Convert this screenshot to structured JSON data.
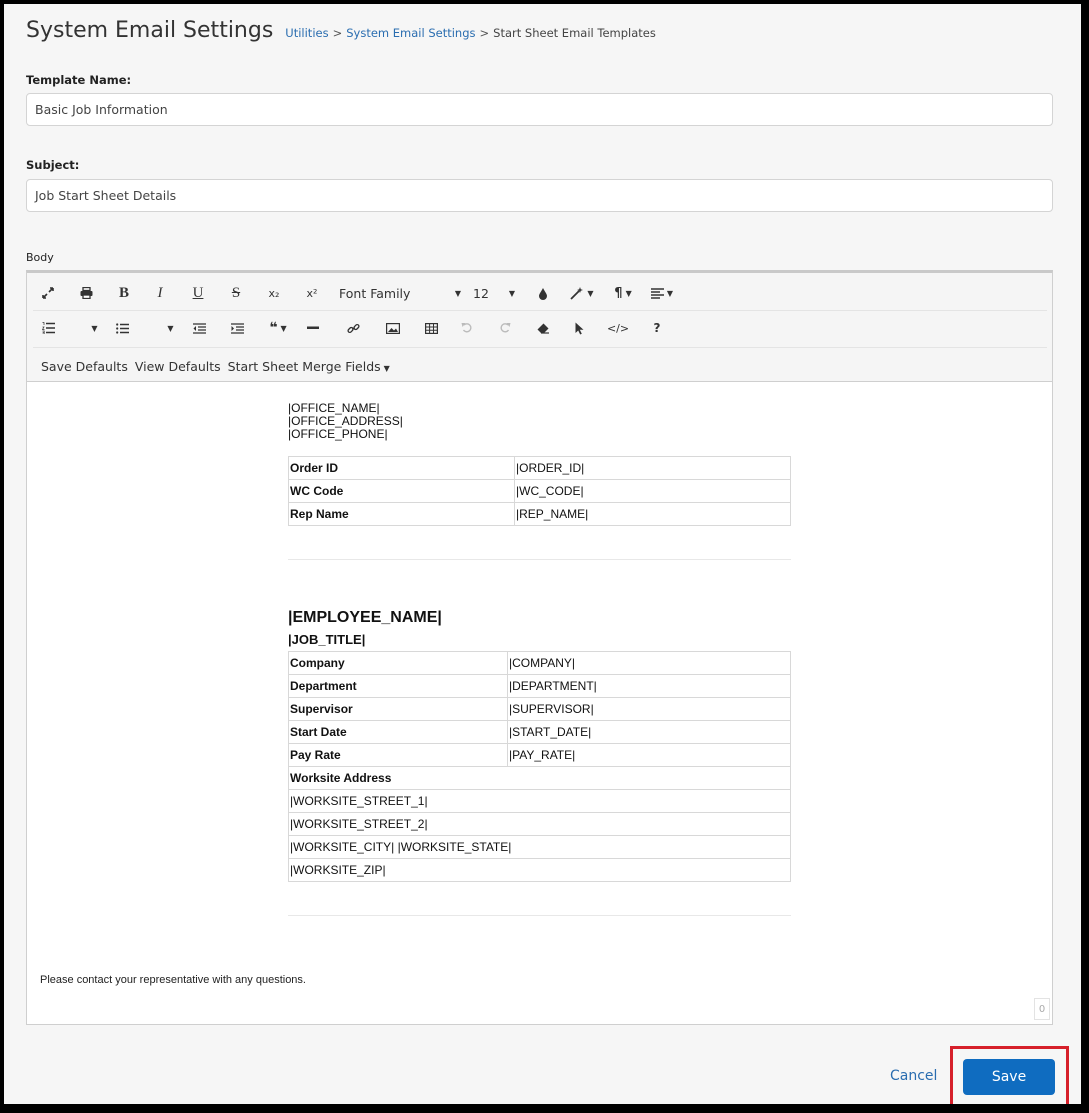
{
  "header": {
    "title": "System Email Settings",
    "breadcrumb": [
      {
        "label": "Utilities"
      },
      {
        "label": "System Email Settings"
      },
      {
        "label": "Start Sheet Email Templates"
      }
    ],
    "separator": ">"
  },
  "form": {
    "template_name_label": "Template Name:",
    "template_name_value": "Basic Job Information",
    "subject_label": "Subject:",
    "subject_value": "Job Start Sheet Details",
    "body_label": "Body"
  },
  "toolbar": {
    "font_family": "Font Family",
    "font_size": "12",
    "bold": "B",
    "italic": "I",
    "underline": "U",
    "strike": "S",
    "subscript": "x₂",
    "superscript": "x²",
    "help": "?",
    "save_defaults": "Save Defaults",
    "view_defaults": "View Defaults",
    "merge_fields": "Start Sheet Merge Fields"
  },
  "body": {
    "office": [
      "|OFFICE_NAME|",
      "|OFFICE_ADDRESS|",
      "|OFFICE_PHONE|"
    ],
    "order_table": [
      {
        "key": "Order ID",
        "value": "|ORDER_ID|"
      },
      {
        "key": "WC Code",
        "value": "|WC_CODE|"
      },
      {
        "key": "Rep Name",
        "value": "|REP_NAME|"
      }
    ],
    "employee_name": "|EMPLOYEE_NAME|",
    "job_title": "|JOB_TITLE|",
    "employee_table": [
      {
        "key": "Company",
        "value": "|COMPANY|"
      },
      {
        "key": "Department",
        "value": "|DEPARTMENT|"
      },
      {
        "key": "Supervisor",
        "value": "|SUPERVISOR|"
      },
      {
        "key": "Start Date",
        "value": "|START_DATE|"
      },
      {
        "key": "Pay Rate",
        "value": "|PAY_RATE|"
      }
    ],
    "worksite_header": "Worksite Address",
    "worksite_lines": [
      "|WORKSITE_STREET_1|",
      "|WORKSITE_STREET_2|",
      "|WORKSITE_CITY| |WORKSITE_STATE|",
      "|WORKSITE_ZIP|"
    ],
    "closing": "Please contact your representative with any questions.",
    "char_count": "0"
  },
  "actions": {
    "cancel": "Cancel",
    "save": "Save"
  },
  "colors": {
    "accent": "#0f6cc0",
    "link": "#2a6db0",
    "highlight": "#d6202b"
  }
}
